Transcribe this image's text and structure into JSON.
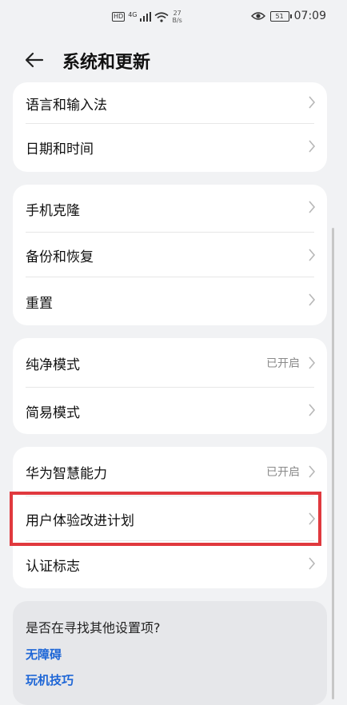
{
  "status_bar": {
    "hd": "HD",
    "network": "4G",
    "speed_value": "27",
    "speed_unit": "B/s",
    "battery": "51",
    "time": "07:09"
  },
  "header": {
    "title": "系统和更新"
  },
  "groups": [
    {
      "items": [
        {
          "label": "语言和输入法"
        },
        {
          "label": "日期和时间"
        }
      ]
    },
    {
      "items": [
        {
          "label": "手机克隆"
        },
        {
          "label": "备份和恢复"
        },
        {
          "label": "重置"
        }
      ]
    },
    {
      "items": [
        {
          "label": "纯净模式",
          "value": "已开启"
        },
        {
          "label": "简易模式"
        }
      ]
    },
    {
      "items": [
        {
          "label": "华为智慧能力",
          "value": "已开启"
        },
        {
          "label": "用户体验改进计划"
        },
        {
          "label": "认证标志"
        }
      ]
    }
  ],
  "help": {
    "title": "是否在寻找其他设置项?",
    "links": [
      "无障碍",
      "玩机技巧"
    ]
  },
  "colors": {
    "background": "#f1f2f4",
    "card": "#ffffff",
    "link": "#1e66d6",
    "highlight": "#e0393e"
  }
}
